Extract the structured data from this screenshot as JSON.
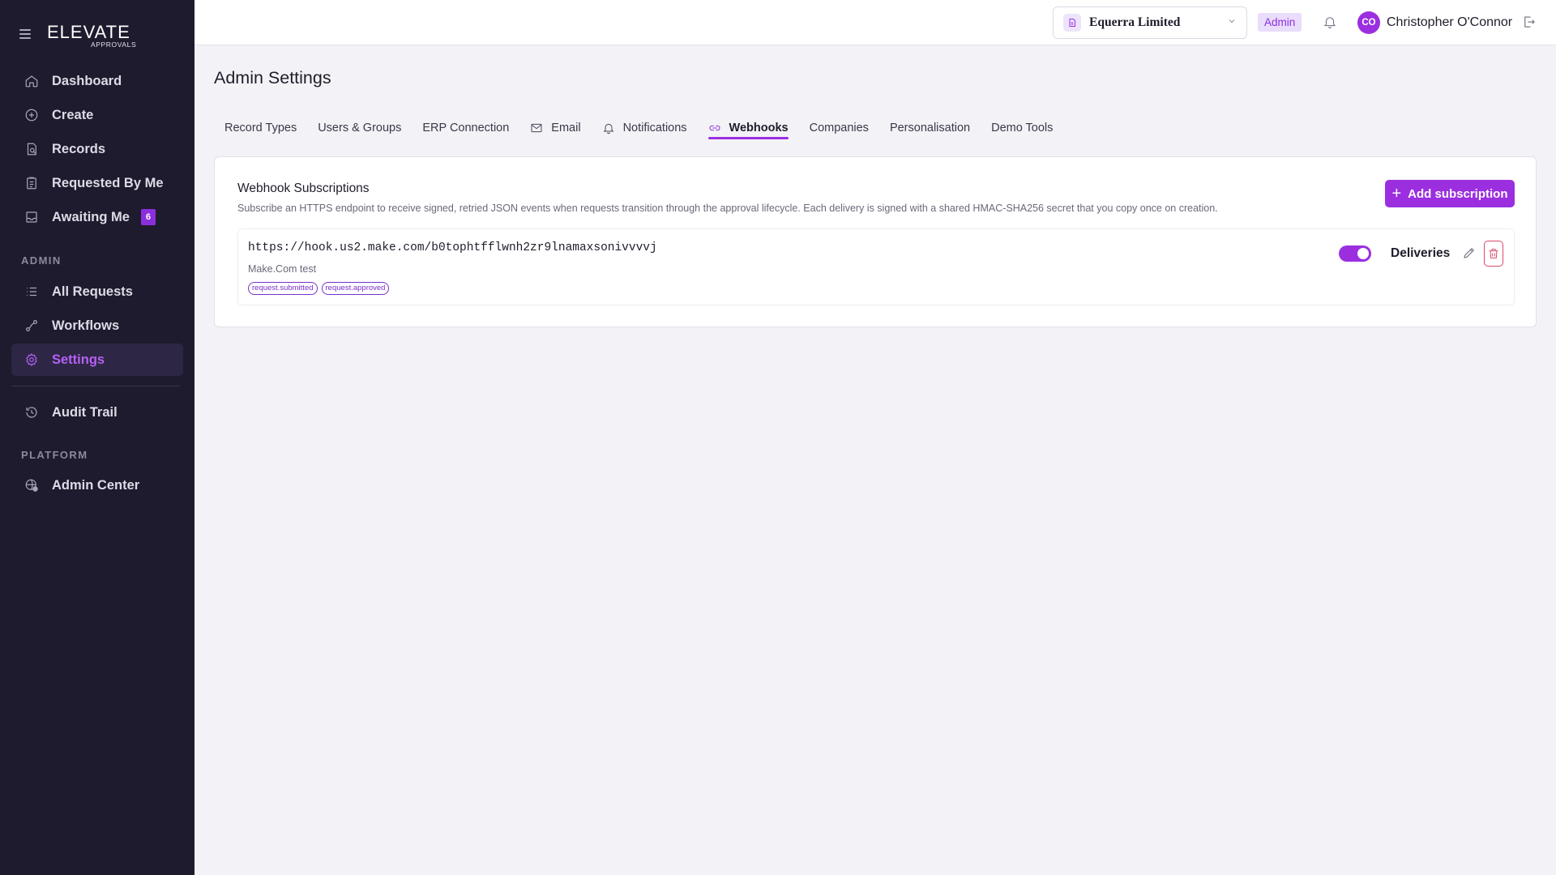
{
  "brand": {
    "logo_text": "ELEVATE",
    "logo_sub": "APPROVALS"
  },
  "sidebar": {
    "main_items": [
      {
        "label": "Dashboard",
        "icon": "home-icon"
      },
      {
        "label": "Create",
        "icon": "plus-circle-icon"
      },
      {
        "label": "Records",
        "icon": "records-icon"
      },
      {
        "label": "Requested By Me",
        "icon": "clipboard-icon"
      },
      {
        "label": "Awaiting Me",
        "icon": "inbox-icon",
        "badge": "6"
      }
    ],
    "admin_label": "ADMIN",
    "admin_items": [
      {
        "label": "All Requests",
        "icon": "list-icon"
      },
      {
        "label": "Workflows",
        "icon": "workflow-icon"
      },
      {
        "label": "Settings",
        "icon": "gear-icon",
        "active": true
      }
    ],
    "audit_item": {
      "label": "Audit Trail",
      "icon": "history-icon"
    },
    "platform_label": "PLATFORM",
    "platform_items": [
      {
        "label": "Admin Center",
        "icon": "globe-check-icon"
      }
    ]
  },
  "topbar": {
    "company": "Equerra Limited",
    "role": "Admin",
    "user_initials": "CO",
    "user_name": "Christopher O'Connor"
  },
  "page": {
    "title": "Admin Settings",
    "tabs": [
      {
        "label": "Record Types"
      },
      {
        "label": "Users & Groups"
      },
      {
        "label": "ERP Connection"
      },
      {
        "label": "Email",
        "icon": "mail-icon"
      },
      {
        "label": "Notifications",
        "icon": "bell-icon"
      },
      {
        "label": "Webhooks",
        "icon": "link-icon",
        "active": true
      },
      {
        "label": "Companies"
      },
      {
        "label": "Personalisation"
      },
      {
        "label": "Demo Tools"
      }
    ]
  },
  "webhooks": {
    "title": "Webhook Subscriptions",
    "description": "Subscribe an HTTPS endpoint to receive signed, retried JSON events when requests transition through the approval lifecycle. Each delivery is signed with a shared HMAC-SHA256 secret that you copy once on creation.",
    "add_label": "Add subscription",
    "subscriptions": [
      {
        "url": "https://hook.us2.make.com/b0tophtfflwnh2zr9lnamaxsonivvvvj",
        "description": "Make.Com test",
        "events": [
          "request.submitted",
          "request.approved"
        ],
        "enabled": true,
        "deliveries_label": "Deliveries"
      }
    ]
  },
  "colors": {
    "accent": "#9b2fe0",
    "sidebar_bg": "#1e1b2e",
    "danger": "#d94a6a"
  }
}
